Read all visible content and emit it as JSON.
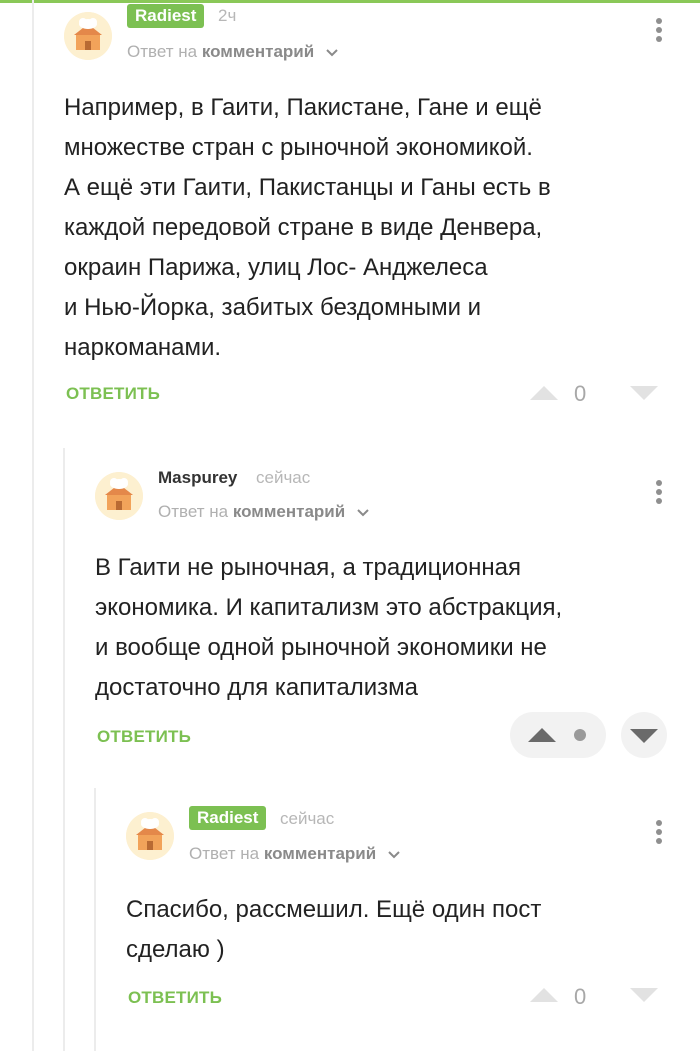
{
  "comments": [
    {
      "author": "Radiest",
      "time": "2ч",
      "reply_prefix": "Ответ на",
      "reply_target": "комментарий",
      "text": "Например, в Гаити, Пакистане, Гане и ещё\nмножестве стран с рыночной экономикой.\nА ещё эти Гаити, Пакистанцы и Ганы есть в\nкаждой передовой стране в виде Денвера,\nокраин Парижа, улиц Лос- Анджелеса\nи Нью-Йорка, забитых бездомными и\nнаркоманами.",
      "reply_label": "ОТВЕТИТЬ",
      "score": "0"
    },
    {
      "author": "Maspurey",
      "time": "сейчас",
      "reply_prefix": "Ответ на",
      "reply_target": "комментарий",
      "text": "В Гаити не рыночная, а традиционная\nэкономика. И капитализм это абстракция,\nи вообще одной рыночной экономики не\nдостаточно для капитализма",
      "reply_label": "ОТВЕТИТЬ",
      "score": ""
    },
    {
      "author": "Radiest",
      "time": "сейчас",
      "reply_prefix": "Ответ на",
      "reply_target": "комментарий",
      "text": "Спасибо, рассмешил. Ещё один пост\nсделаю )",
      "reply_label": "ОТВЕТИТЬ",
      "score": "0"
    }
  ],
  "colors": {
    "accent": "#7cc052",
    "badge": "#7cc052",
    "muted": "#b0b0b0"
  },
  "icons": {
    "avatar": "bakery-house-avatar",
    "more": "kebab-menu-icon",
    "upvote": "upvote-arrow-icon",
    "downvote": "downvote-arrow-icon",
    "expand": "chevron-down-icon"
  }
}
